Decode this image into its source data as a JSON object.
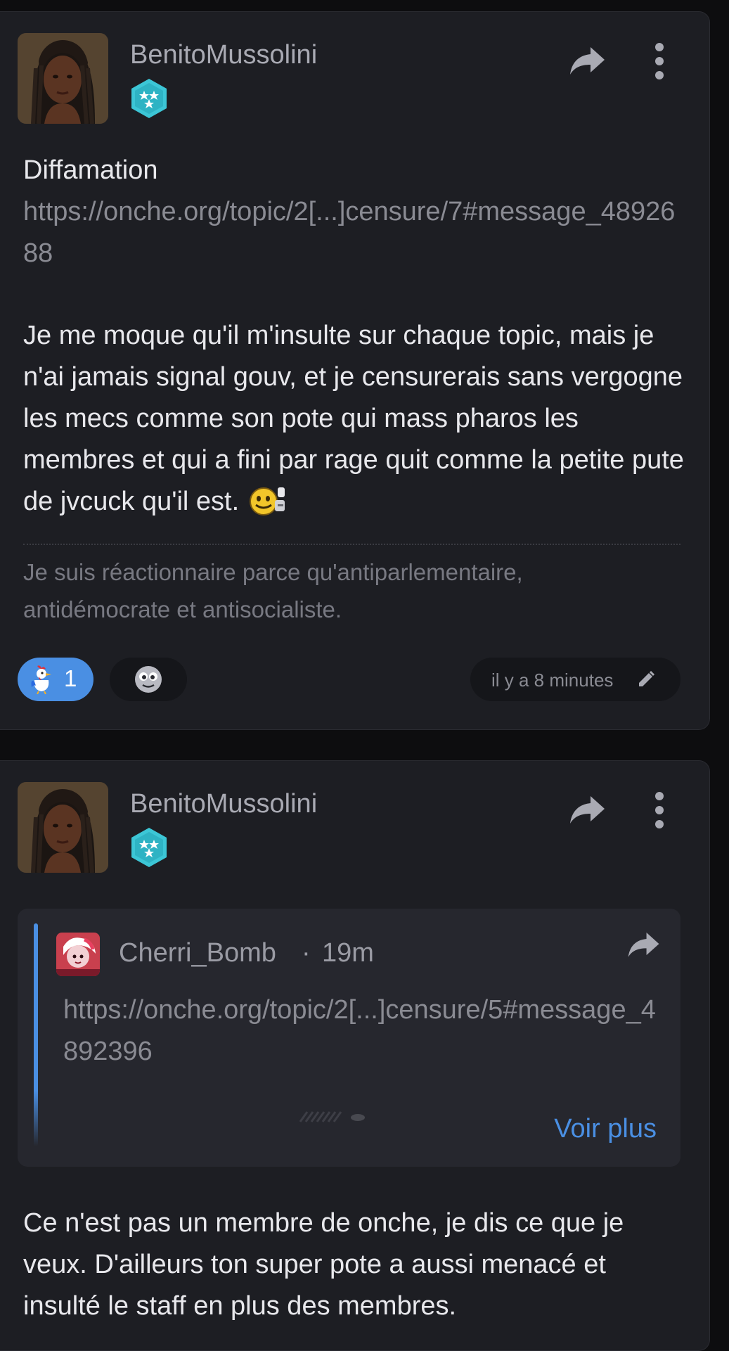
{
  "posts": [
    {
      "author": "BenitoMussolini",
      "title": "Diffamation",
      "link": "https://onche.org/topic/2[...]censure/7#message_4892688",
      "body": "Je me moque qu'il m'insulte sur chaque topic, mais je n'ai jamais signal gouv, et je censurerais sans vergogne les mecs comme son pote qui mass pharos les membres et qui a fini par rage quit comme la petite pute de jvcuck qu'il est.",
      "signature": "Je suis réactionnaire parce qu'antiparlementaire, antidémocrate et antisocialiste.",
      "reaction_count": "1",
      "timestamp": "il y a 8 minutes"
    },
    {
      "author": "BenitoMussolini",
      "quote": {
        "author": "Cherri_Bomb",
        "separator": "·",
        "time": "19m",
        "link": "https://onche.org/topic/2[...]censure/5#message_4892396",
        "more_label": "Voir plus"
      },
      "body": "Ce n'est pas un membre de onche, je dis ce que je veux. D'ailleurs ton super pote a aussi menacé et insulté le staff en plus des membres."
    }
  ],
  "icons": {
    "share": "share-arrow-icon",
    "more": "more-vertical-icon",
    "badge": "rank-star-badge-icon",
    "reaction": "rooster-reaction-icon",
    "add_reaction": "smiley-add-icon",
    "edit": "pencil-icon",
    "inline_emoji": "sticker-emoji-icon"
  },
  "colors": {
    "background": "#0d0d0f",
    "card": "#1d1e23",
    "quote_card": "#26272e",
    "accent": "#4a8fe3",
    "badge": "#3cc6d6",
    "muted_text": "#8a8b93"
  }
}
